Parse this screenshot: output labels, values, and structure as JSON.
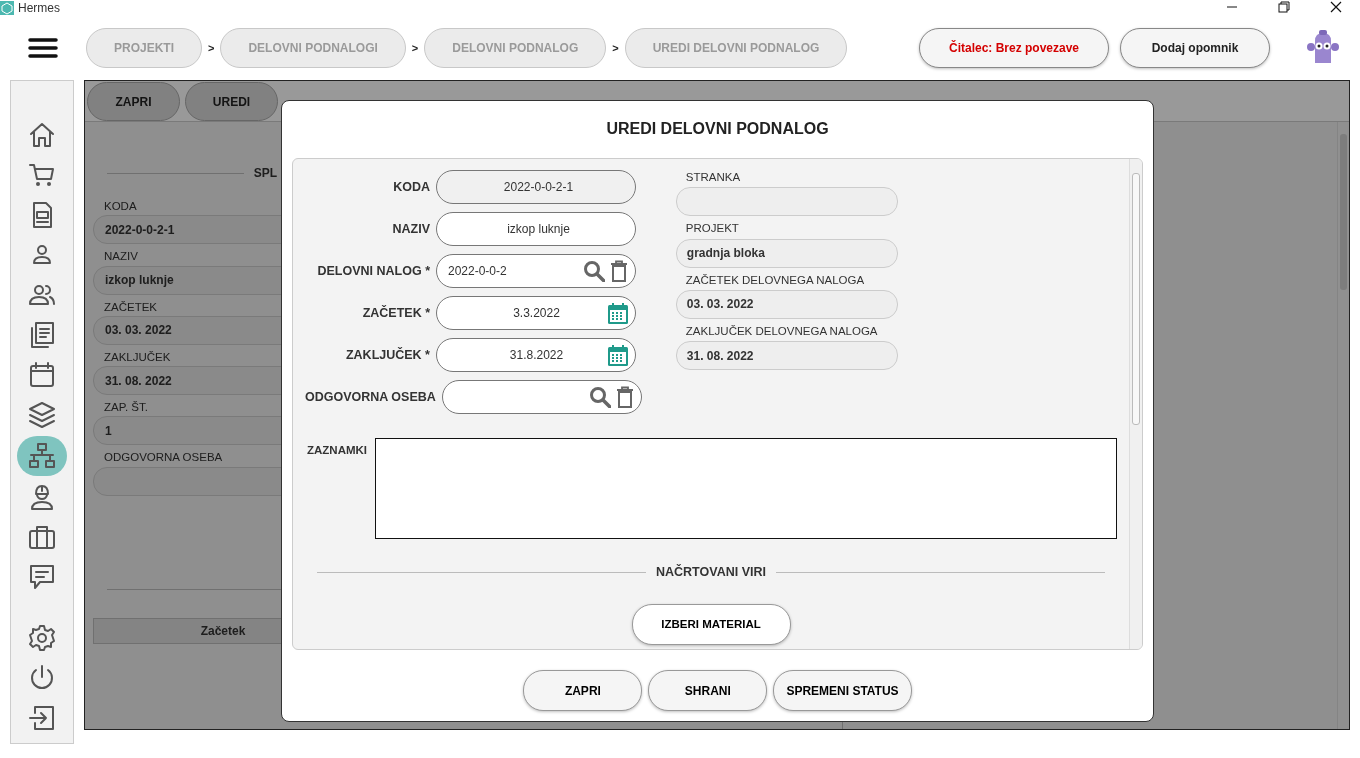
{
  "app": {
    "title": "Hermes"
  },
  "breadcrumbs": [
    "PROJEKTI",
    "DELOVNI PODNALOGI",
    "DELOVNI PODNALOG",
    "UREDI DELOVNI PODNALOG"
  ],
  "breadcrumb_separators": [
    ">",
    ">",
    ">"
  ],
  "header_buttons": [
    {
      "label": "Čitalec: Brez povezave",
      "kind": "alert"
    },
    {
      "label": "Dodaj opomnik",
      "kind": "normal"
    }
  ],
  "sidebar": {
    "items": [
      {
        "selected": false
      },
      {
        "selected": false
      },
      {
        "selected": false
      },
      {
        "selected": false
      },
      {
        "selected": false
      },
      {
        "selected": false
      },
      {
        "selected": false
      },
      {
        "selected": false
      },
      {
        "selected": true
      },
      {
        "selected": false
      },
      {
        "selected": false
      },
      {
        "selected": false
      }
    ],
    "bottom_items": [
      {
        "selected": false
      },
      {
        "selected": false
      },
      {
        "selected": false
      }
    ]
  },
  "background": {
    "buttons": [
      "ZAPRI",
      "UREDI"
    ],
    "section_title": "SPL",
    "fields": [
      {
        "label": "KODA",
        "value": "2022-0-0-2-1"
      },
      {
        "label": "NAZIV",
        "value": "izkop luknje"
      },
      {
        "label": "ZAČETEK",
        "value": "03. 03. 2022"
      },
      {
        "label": "ZAKLJUČEK",
        "value": "31. 08. 2022"
      },
      {
        "label": "ZAP. ŠT.",
        "value": "1"
      },
      {
        "label": "ODGOVORNA OSEBA"
      }
    ],
    "table": {
      "columns": [
        "Začetek"
      ]
    }
  },
  "dialog": {
    "title": "UREDI DELOVNI PODNALOG",
    "fields": [
      {
        "label": "KODA",
        "value": "2022-0-0-2-1",
        "kind": "readonly"
      },
      {
        "label": "NAZIV",
        "value": "izkop luknje",
        "kind": "text"
      },
      {
        "label": "DELOVNI NALOG *",
        "value": "2022-0-0-2",
        "kind": "lookup"
      },
      {
        "label": "ZAČETEK *",
        "value": "3.3.2022",
        "kind": "date"
      },
      {
        "label": "ZAKLJUČEK *",
        "value": "31.8.2022",
        "kind": "date"
      },
      {
        "label": "ODGOVORNA OSEBA",
        "kind": "lookup"
      }
    ],
    "info": [
      {
        "label": "STRANKA"
      },
      {
        "label": "PROJEKT",
        "value": "gradnja bloka"
      },
      {
        "label": "ZAČETEK DELOVNEGA NALOGA",
        "value": "03. 03. 2022"
      },
      {
        "label": "ZAKLJUČEK DELOVNEGA NALOGA",
        "value": "31. 08. 2022"
      }
    ],
    "notes": {
      "label": "ZAZNAMKI"
    },
    "section_title": "NAČRTOVANI VIRI",
    "section_button": "IZBERI MATERIAL",
    "buttons": [
      "ZAPRI",
      "SHRANI",
      "SPREMENI STATUS"
    ]
  }
}
